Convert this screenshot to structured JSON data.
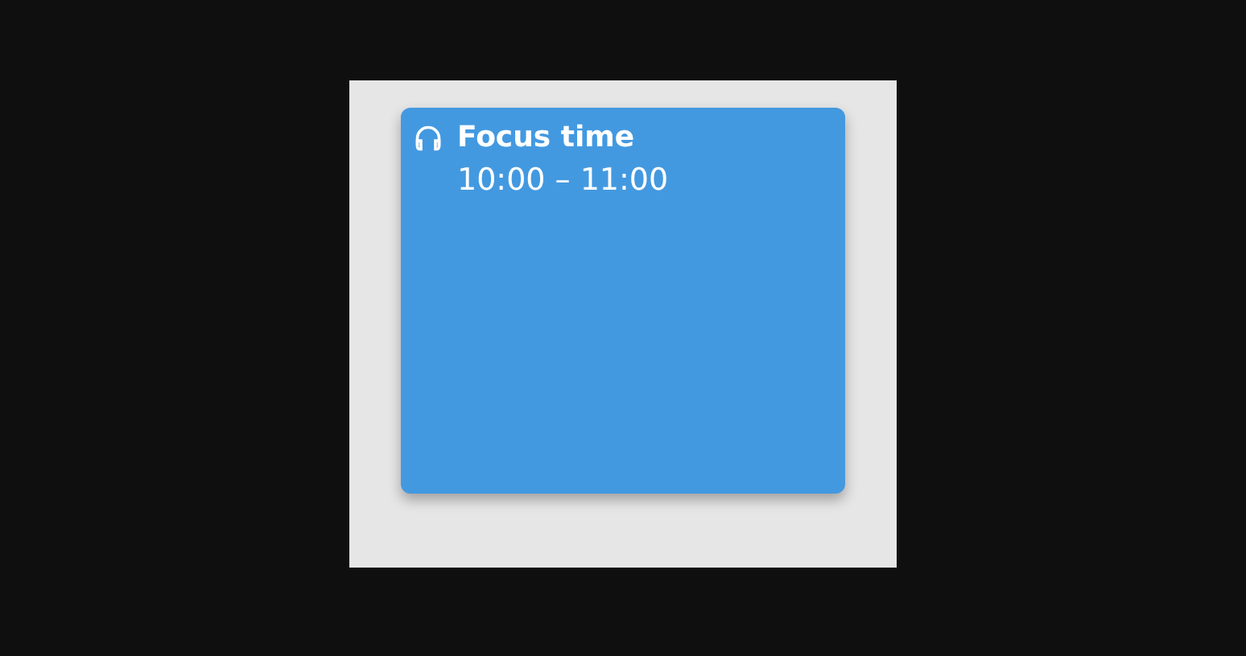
{
  "event": {
    "title": "Focus time",
    "time": "10:00 – 11:00",
    "color": "#4399e0"
  }
}
